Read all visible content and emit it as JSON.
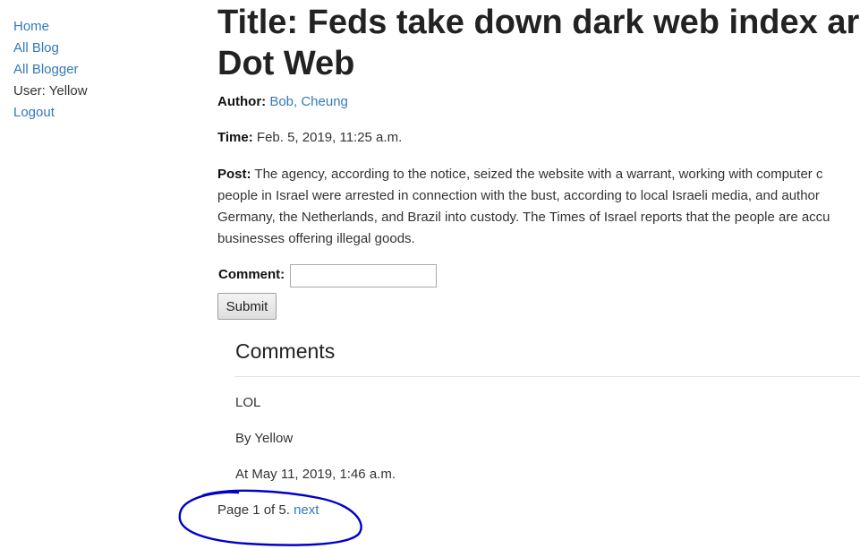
{
  "nav": {
    "home": "Home",
    "all_blog": "All Blog",
    "all_blogger": "All Blogger",
    "user": "User: Yellow",
    "logout": "Logout"
  },
  "post": {
    "title_line1": "Title: Feds take down dark web index ar",
    "title_line2": "Dot Web",
    "author_label": "Author:",
    "author_value": "Bob, Cheung",
    "time_label": "Time:",
    "time_value": "Feb. 5, 2019, 11:25 a.m.",
    "post_label": "Post:",
    "body_line1": "The agency, according to the notice, seized the website with a warrant, working with computer c",
    "body_line2": "people in Israel were arrested in connection with the bust, according to local Israeli media, and author",
    "body_line3": "Germany, the Netherlands, and Brazil into custody. The Times of Israel reports that the people are accu",
    "body_line4": "businesses offering illegal goods."
  },
  "comment_form": {
    "label": "Comment:",
    "value": "",
    "submit_label": "Submit"
  },
  "comments": {
    "heading": "Comments",
    "items": [
      {
        "text": "LOL",
        "by": "By Yellow",
        "at": "At May 11, 2019, 1:46 a.m."
      }
    ]
  },
  "pagination": {
    "status": "Page 1 of 5.",
    "next_label": "next"
  },
  "annotation": {
    "color": "#0000cc"
  }
}
